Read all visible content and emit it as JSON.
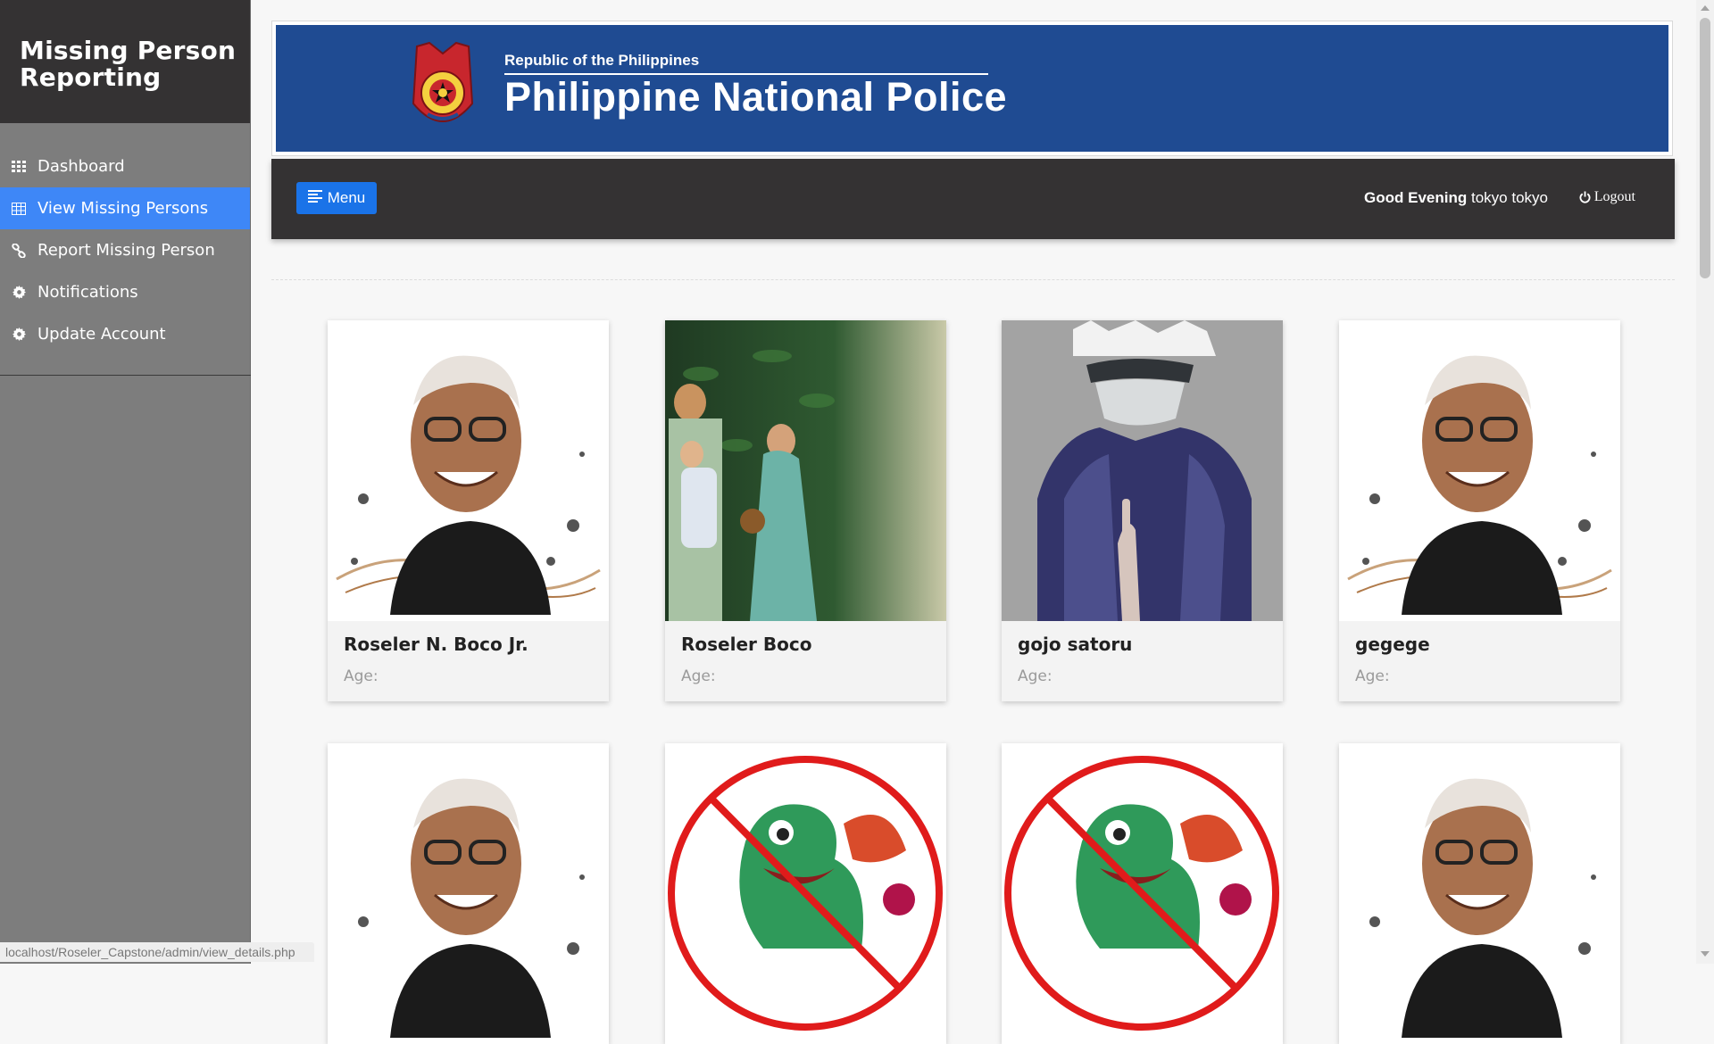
{
  "sidebar": {
    "title": "Missing Person Reporting",
    "items": [
      {
        "label": "Dashboard",
        "icon": "grid-icon",
        "active": false
      },
      {
        "label": "View Missing Persons",
        "icon": "table-icon",
        "active": true
      },
      {
        "label": "Report Missing Person",
        "icon": "link-icon",
        "active": false
      },
      {
        "label": "Notifications",
        "icon": "gear-icon",
        "active": false
      },
      {
        "label": "Update Account",
        "icon": "gear-icon",
        "active": false
      }
    ]
  },
  "banner": {
    "subtitle": "Republic of the Philippines",
    "title": "Philippine National Police",
    "color": "#1f4b92"
  },
  "topbar": {
    "menu_label": "Menu",
    "greeting": "Good Evening",
    "user": "tokyo tokyo",
    "logout_label": "Logout"
  },
  "cards": [
    {
      "name": "Roseler N. Boco Jr.",
      "age_label": "Age:",
      "image": "elderly-man-portrait"
    },
    {
      "name": "Roseler Boco",
      "age_label": "Age:",
      "image": "family-photo"
    },
    {
      "name": "gojo satoru",
      "age_label": "Age:",
      "image": "anime-character"
    },
    {
      "name": "gegege",
      "age_label": "Age:",
      "image": "elderly-man-portrait"
    },
    {
      "name": "",
      "age_label": "",
      "image": "elderly-man-portrait"
    },
    {
      "name": "",
      "age_label": "",
      "image": "crossed-out-dragon"
    },
    {
      "name": "",
      "age_label": "",
      "image": "crossed-out-dragon"
    },
    {
      "name": "",
      "age_label": "",
      "image": "elderly-man-portrait"
    }
  ],
  "status_bar": {
    "url": "localhost/Roseler_Capstone/admin/view_details.php"
  },
  "colors": {
    "accent": "#3e87f7",
    "button": "#1a73e8",
    "sidebar_bg": "#7d7d7d",
    "dark": "#343233"
  }
}
